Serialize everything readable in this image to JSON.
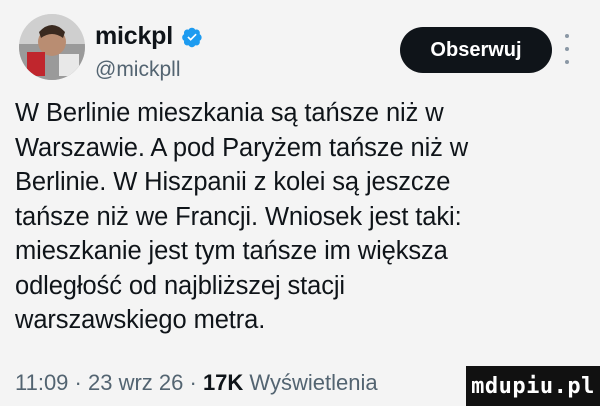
{
  "author": {
    "display_name": "mickpl",
    "handle": "@mickpll",
    "verified_icon": "verified-badge-icon",
    "accent_color": "#1d9bf0"
  },
  "actions": {
    "follow_label": "Obserwuj",
    "more_icon": "more-vertical-icon"
  },
  "tweet": {
    "lines": [
      "W Berlinie mieszkania są tańsze niż w",
      "Warszawie. A pod Paryżem tańsze niż w",
      "Berlinie. W Hiszpanii z kolei są jeszcze",
      "tańsze niż we Francji. Wniosek jest taki:",
      "mieszkanie jest tym tańsze im większa",
      "odległość od najbliższej stacji",
      "warszawskiego metra."
    ]
  },
  "meta": {
    "time": "11:09",
    "sep1": " · ",
    "date": "23 wrz 26",
    "sep2": " · ",
    "views_count": "17K",
    "views_label": " Wyświetlenia"
  },
  "watermark": "mdupiu.pl"
}
